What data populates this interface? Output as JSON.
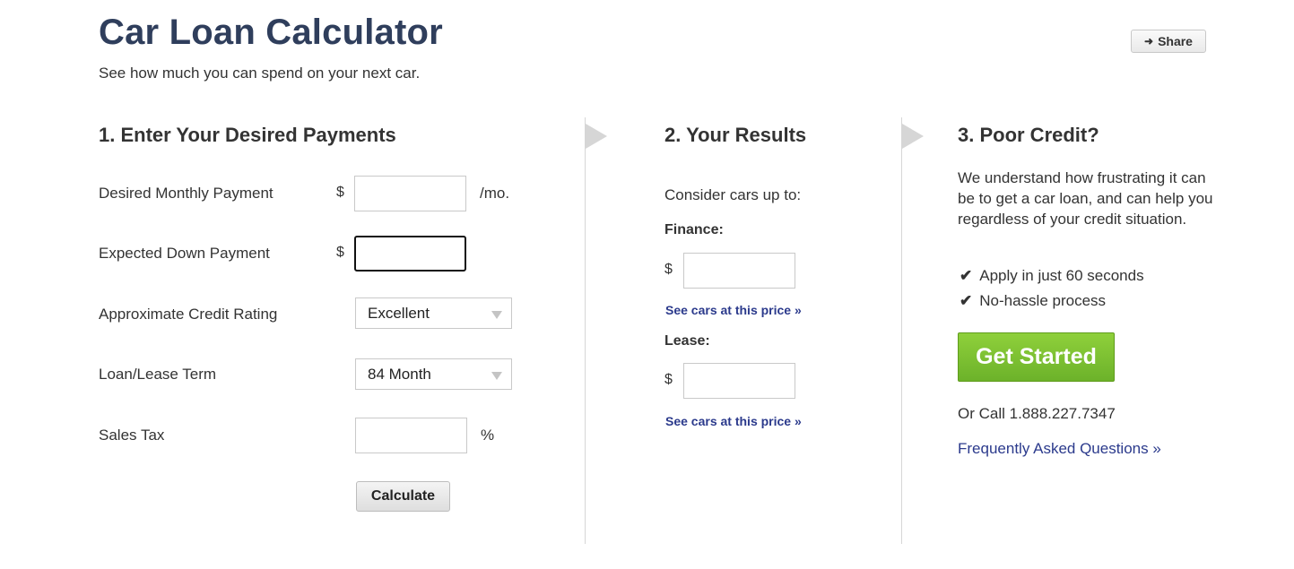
{
  "header": {
    "title": "Car Loan Calculator",
    "subtitle": "See how much you can spend on your next car.",
    "share_label": "Share"
  },
  "section1": {
    "heading": "1. Enter Your Desired Payments",
    "monthly_payment": {
      "label": "Desired Monthly Payment",
      "prefix": "$",
      "suffix": "/mo.",
      "value": ""
    },
    "down_payment": {
      "label": "Expected Down Payment",
      "prefix": "$",
      "value": ""
    },
    "credit_rating": {
      "label": "Approximate Credit Rating",
      "selected": "Excellent"
    },
    "term": {
      "label": "Loan/Lease Term",
      "selected": "84 Month"
    },
    "sales_tax": {
      "label": "Sales Tax",
      "suffix": "%",
      "value": ""
    },
    "calculate_label": "Calculate"
  },
  "section2": {
    "heading": "2. Your Results",
    "intro": "Consider cars up to:",
    "finance": {
      "label": "Finance:",
      "prefix": "$",
      "value": "",
      "link": "See cars at this price »"
    },
    "lease": {
      "label": "Lease:",
      "prefix": "$",
      "value": "",
      "link": "See cars at this price »"
    }
  },
  "section3": {
    "heading": "3. Poor Credit?",
    "description": "We understand how frustrating it can be to get a car loan, and can help you regardless of your credit situation.",
    "checklist": [
      "Apply in just 60 seconds",
      "No-hassle process"
    ],
    "cta_label": "Get Started",
    "call_text": "Or Call 1.888.227.7347",
    "faq_link": "Frequently Asked Questions »"
  },
  "colors": {
    "title": "#2f3e5c",
    "link": "#2b3a8c",
    "cta_green": "#7cc232",
    "divider": "#d6d6d6"
  },
  "icons": {
    "share": "sign-in-arrow-icon",
    "check": "checkmark-icon",
    "select": "caret-down-icon",
    "section_arrow": "triangle-right-icon"
  }
}
